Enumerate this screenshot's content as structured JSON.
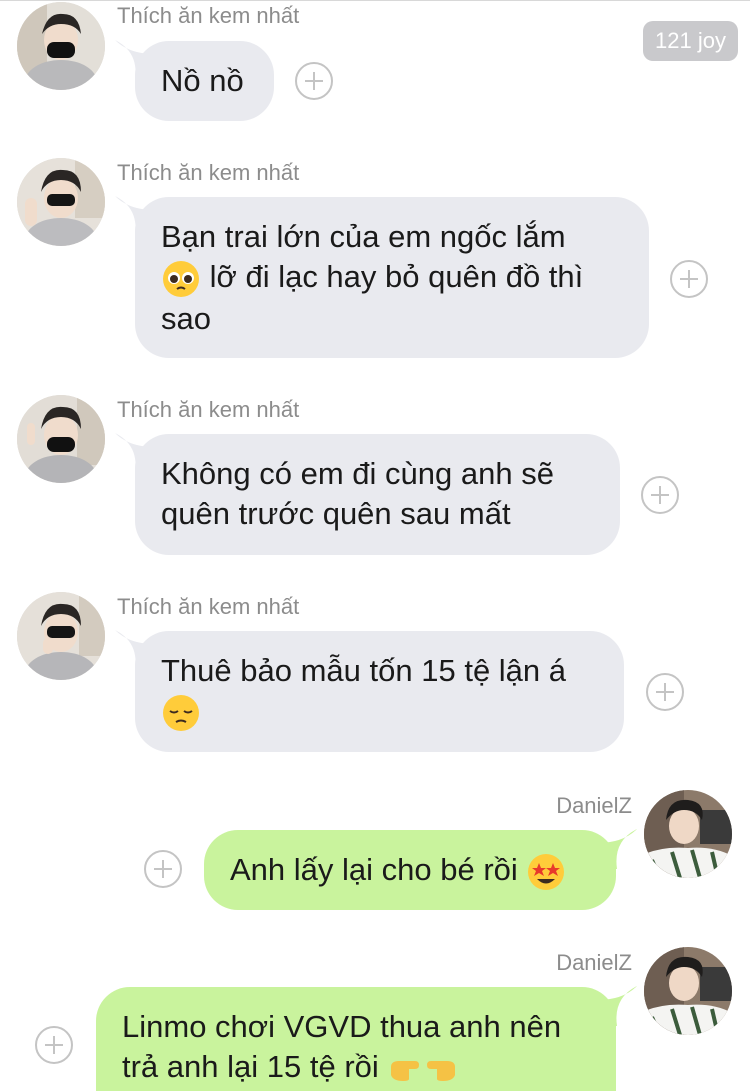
{
  "chat": {
    "joy_badge": "121 joy",
    "messages": [
      {
        "sender": "Thích ăn kem nhất",
        "text": "Nồ nồ",
        "direction": "incoming"
      },
      {
        "sender": "Thích ăn kem nhất",
        "line1": "Bạn trai lớn của em ngốc lắm",
        "line2": "lỡ đi lạc hay bỏ quên đồ thì",
        "line3": "sao",
        "emoji": "pleading-face-emoji",
        "direction": "incoming"
      },
      {
        "sender": "Thích ăn kem nhất",
        "line1": "Không có em đi cùng anh sẽ",
        "line2": "quên trước quên sau mất",
        "direction": "incoming"
      },
      {
        "sender": "Thích ăn kem nhất",
        "line1": "Thuê bảo mẫu tốn 15 tệ lận á",
        "emoji": "pensive-face-emoji",
        "direction": "incoming"
      },
      {
        "sender": "DanielZ",
        "text": "Anh lấy lại cho bé rồi",
        "emoji": "star-struck-emoji",
        "direction": "outgoing"
      },
      {
        "sender": "DanielZ",
        "line1": "Linmo chơi VGVD thua anh nên",
        "line2": "trả anh lại 15 tệ rồi",
        "emoji": "pointing-hands-emoji",
        "direction": "outgoing"
      }
    ]
  },
  "colors": {
    "incoming_bubble": "#e9eaef",
    "outgoing_bubble": "#c9f39d",
    "sender_name": "#8c8c8c",
    "joy_badge": "#c9c9cc"
  }
}
